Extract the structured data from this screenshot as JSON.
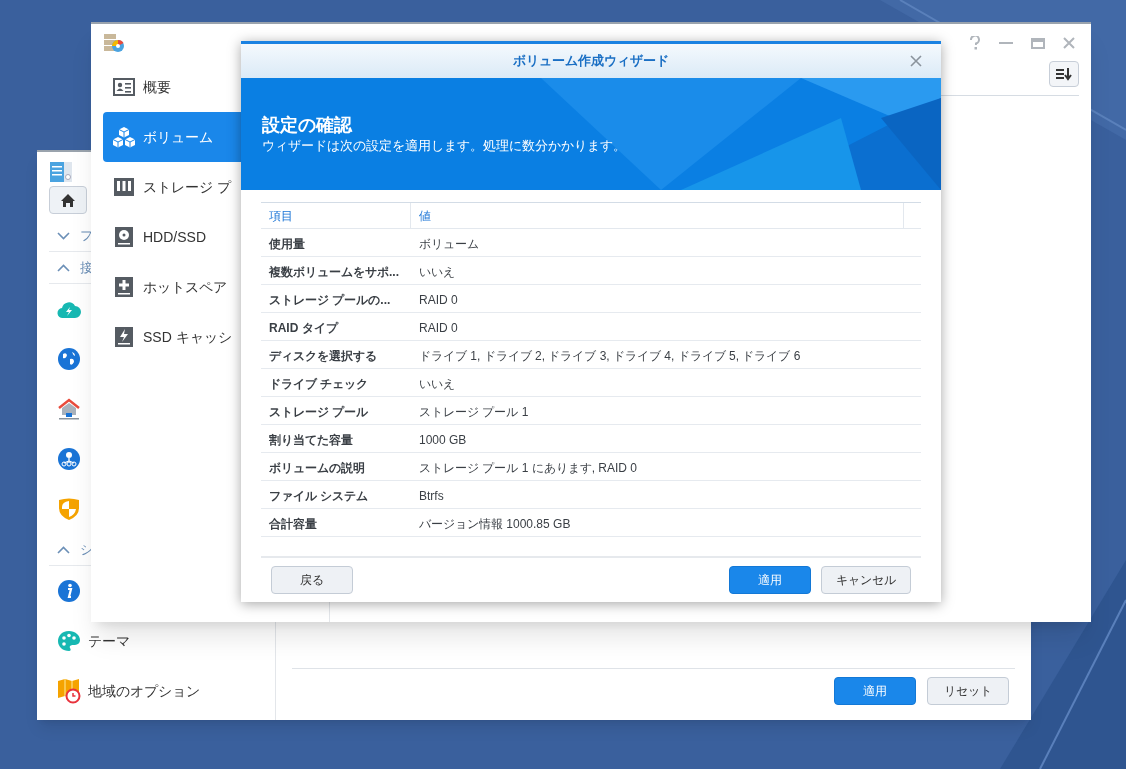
{
  "control_panel": {
    "sidebar": [
      {
        "kind": "section",
        "label": "フ",
        "expanded": false
      },
      {
        "kind": "section",
        "label": "接",
        "expanded": true
      },
      {
        "kind": "item"
      },
      {
        "kind": "item"
      },
      {
        "kind": "item"
      },
      {
        "kind": "item"
      },
      {
        "kind": "item"
      },
      {
        "kind": "section",
        "label": "シ",
        "expanded": true
      },
      {
        "kind": "item"
      },
      {
        "kind": "item",
        "label": "テーマ"
      },
      {
        "kind": "item",
        "label": "地域のオプション"
      }
    ],
    "buttons": [
      {
        "label": "適用",
        "primary": true
      },
      {
        "label": "リセット",
        "primary": false
      }
    ]
  },
  "storage_manager": {
    "nav": [
      {
        "label": "概要",
        "selected": false
      },
      {
        "label": "ボリューム",
        "selected": true
      },
      {
        "label": "ストレージ プ",
        "selected": false
      },
      {
        "label": "HDD/SSD",
        "selected": false
      },
      {
        "label": "ホットスペア",
        "selected": false
      },
      {
        "label": "SSD キャッシ",
        "selected": false
      }
    ]
  },
  "wizard": {
    "title": "ボリューム作成ウィザード",
    "heading": "設定の確認",
    "subtitle": "ウィザードは次の設定を適用します。処理に数分かかります。",
    "columns": [
      "項目",
      "値"
    ],
    "rows": [
      {
        "item": "使用量",
        "value": "ボリューム"
      },
      {
        "item": "複数ボリュームをサポ...",
        "value": "いいえ"
      },
      {
        "item": "ストレージ プールの...",
        "value": "RAID 0"
      },
      {
        "item": "RAID タイプ",
        "value": "RAID 0"
      },
      {
        "item": "ディスクを選択する",
        "value": "ドライブ 1, ドライブ 2, ドライブ 3, ドライブ 4, ドライブ 5, ドライブ 6"
      },
      {
        "item": "ドライブ チェック",
        "value": "いいえ"
      },
      {
        "item": "ストレージ プール",
        "value": "ストレージ プール 1"
      },
      {
        "item": "割り当てた容量",
        "value": "1000 GB"
      },
      {
        "item": "ボリュームの説明",
        "value": "ストレージ プール 1 にあります, RAID 0"
      },
      {
        "item": "ファイル システム",
        "value": "Btrfs"
      },
      {
        "item": "合計容量",
        "value": "バージョン情報 1000.85 GB"
      }
    ],
    "buttons": [
      {
        "label": "戻る",
        "primary": false
      },
      {
        "label": "適用",
        "primary": true
      },
      {
        "label": "キャンセル",
        "primary": false
      }
    ]
  }
}
